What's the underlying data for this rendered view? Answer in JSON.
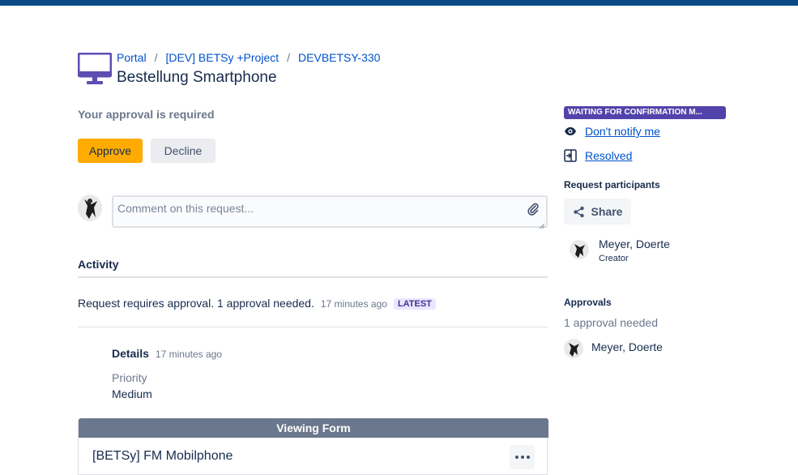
{
  "breadcrumb": {
    "items": [
      "Portal",
      "[DEV] BETSy +Project",
      "DEVBETSY-330"
    ],
    "separator": "/"
  },
  "request": {
    "title": "Bestellung Smartphone",
    "icon": "monitor-icon"
  },
  "approval": {
    "prompt": "Your approval is required",
    "approve_label": "Approve",
    "decline_label": "Decline"
  },
  "comment": {
    "placeholder": "Comment on this request..."
  },
  "activity": {
    "heading": "Activity",
    "entry_text": "Request requires approval. 1 approval needed.",
    "entry_time": "17 minutes ago",
    "entry_badge": "LATEST",
    "details_label": "Details",
    "details_time": "17 minutes ago",
    "priority_label": "Priority",
    "priority_value": "Medium"
  },
  "form": {
    "banner": "Viewing Form",
    "title": "[BETSy] FM Mobilphone"
  },
  "sidebar": {
    "status": "WAITING FOR CONFIRMATION M...",
    "notify_label": "Don't notify me",
    "resolved_label": "Resolved",
    "participants_heading": "Request participants",
    "share_label": "Share",
    "participant": {
      "name": "Meyer, Doerte",
      "role": "Creator"
    },
    "approvals_heading": "Approvals",
    "approvals_needed": "1 approval needed",
    "approver_name": "Meyer, Doerte"
  },
  "colors": {
    "topbar": "#0a4a87",
    "link": "#0052cc",
    "approve": "#ffab00",
    "status": "#5243aa",
    "icon_purple": "#5e4db2"
  }
}
